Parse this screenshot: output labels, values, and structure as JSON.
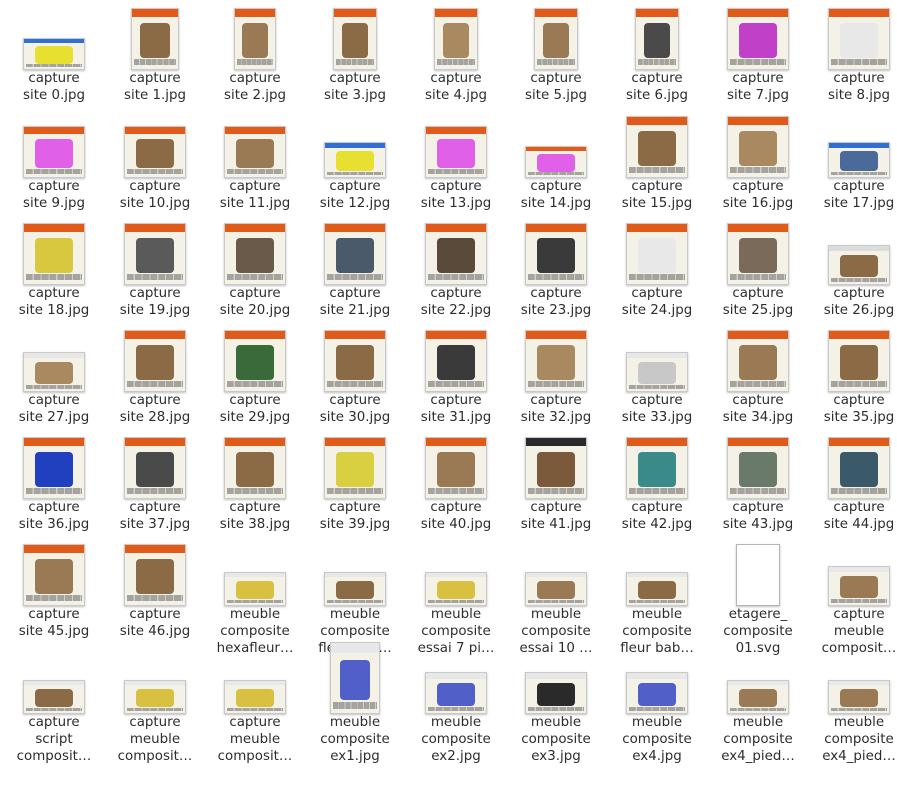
{
  "files": [
    {
      "line1": "capture",
      "line2": "site 0.jpg",
      "thumb": {
        "w": 62,
        "h": 32,
        "bar": "#3070d0",
        "obj": "#e8e030"
      }
    },
    {
      "line1": "capture",
      "line2": "site 1.jpg",
      "thumb": {
        "w": 48,
        "h": 62,
        "bar": "#e05a1a",
        "obj": "#8a6b45"
      }
    },
    {
      "line1": "capture",
      "line2": "site 2.jpg",
      "thumb": {
        "w": 42,
        "h": 62,
        "bar": "#e05a1a",
        "obj": "#9a7a55"
      }
    },
    {
      "line1": "capture",
      "line2": "site 3.jpg",
      "thumb": {
        "w": 44,
        "h": 62,
        "bar": "#e05a1a",
        "obj": "#8a6b45"
      }
    },
    {
      "line1": "capture",
      "line2": "site 4.jpg",
      "thumb": {
        "w": 44,
        "h": 62,
        "bar": "#e05a1a",
        "obj": "#a98a60"
      }
    },
    {
      "line1": "capture",
      "line2": "site 5.jpg",
      "thumb": {
        "w": 44,
        "h": 62,
        "bar": "#e05a1a",
        "obj": "#9a7a55"
      }
    },
    {
      "line1": "capture",
      "line2": "site 6.jpg",
      "thumb": {
        "w": 44,
        "h": 62,
        "bar": "#e05a1a",
        "obj": "#4a4a4a"
      }
    },
    {
      "line1": "capture",
      "line2": "site 7.jpg",
      "thumb": {
        "w": 62,
        "h": 62,
        "bar": "#e05a1a",
        "obj": "#c040c8"
      }
    },
    {
      "line1": "capture",
      "line2": "site 8.jpg",
      "thumb": {
        "w": 62,
        "h": 62,
        "bar": "#e05a1a",
        "obj": "#e8e8e8"
      }
    },
    {
      "line1": "capture",
      "line2": "site 9.jpg",
      "thumb": {
        "w": 62,
        "h": 52,
        "bar": "#e05a1a",
        "obj": "#e060e8"
      }
    },
    {
      "line1": "capture",
      "line2": "site 10.jpg",
      "thumb": {
        "w": 62,
        "h": 52,
        "bar": "#e05a1a",
        "obj": "#8a6b45"
      }
    },
    {
      "line1": "capture",
      "line2": "site 11.jpg",
      "thumb": {
        "w": 62,
        "h": 52,
        "bar": "#e05a1a",
        "obj": "#9a7a55"
      }
    },
    {
      "line1": "capture",
      "line2": "site 12.jpg",
      "thumb": {
        "w": 62,
        "h": 36,
        "bar": "#3070d0",
        "obj": "#e8e030"
      }
    },
    {
      "line1": "capture",
      "line2": "site 13.jpg",
      "thumb": {
        "w": 62,
        "h": 52,
        "bar": "#e05a1a",
        "obj": "#e060e8"
      }
    },
    {
      "line1": "capture",
      "line2": "site 14.jpg",
      "thumb": {
        "w": 62,
        "h": 32,
        "bar": "#e05a1a",
        "obj": "#e060e8"
      }
    },
    {
      "line1": "capture",
      "line2": "site 15.jpg",
      "thumb": {
        "w": 62,
        "h": 62,
        "bar": "#e05a1a",
        "obj": "#8a6b45"
      }
    },
    {
      "line1": "capture",
      "line2": "site 16.jpg",
      "thumb": {
        "w": 62,
        "h": 62,
        "bar": "#e05a1a",
        "obj": "#a98a60"
      }
    },
    {
      "line1": "capture",
      "line2": "site 17.jpg",
      "thumb": {
        "w": 62,
        "h": 36,
        "bar": "#3070d0",
        "obj": "#4a6a9a"
      }
    },
    {
      "line1": "capture",
      "line2": "site 18.jpg",
      "thumb": {
        "w": 62,
        "h": 62,
        "bar": "#e05a1a",
        "obj": "#d8c840"
      }
    },
    {
      "line1": "capture",
      "line2": "site 19.jpg",
      "thumb": {
        "w": 62,
        "h": 62,
        "bar": "#e05a1a",
        "obj": "#5a5a5a"
      }
    },
    {
      "line1": "capture",
      "line2": "site 20.jpg",
      "thumb": {
        "w": 62,
        "h": 62,
        "bar": "#e05a1a",
        "obj": "#6a5a4a"
      }
    },
    {
      "line1": "capture",
      "line2": "site 21.jpg",
      "thumb": {
        "w": 62,
        "h": 62,
        "bar": "#e05a1a",
        "obj": "#4a5a6a"
      }
    },
    {
      "line1": "capture",
      "line2": "site 22.jpg",
      "thumb": {
        "w": 62,
        "h": 62,
        "bar": "#e05a1a",
        "obj": "#5a4a3a"
      }
    },
    {
      "line1": "capture",
      "line2": "site 23.jpg",
      "thumb": {
        "w": 62,
        "h": 62,
        "bar": "#e05a1a",
        "obj": "#3a3a3a"
      }
    },
    {
      "line1": "capture",
      "line2": "site 24.jpg",
      "thumb": {
        "w": 62,
        "h": 62,
        "bar": "#e05a1a",
        "obj": "#e8e8e8"
      }
    },
    {
      "line1": "capture",
      "line2": "site 25.jpg",
      "thumb": {
        "w": 62,
        "h": 62,
        "bar": "#e05a1a",
        "obj": "#7a6a5a"
      }
    },
    {
      "line1": "capture",
      "line2": "site 26.jpg",
      "thumb": {
        "w": 62,
        "h": 40,
        "bar": "#dcdcdc",
        "obj": "#8a6b45"
      }
    },
    {
      "line1": "capture",
      "line2": "site 27.jpg",
      "thumb": {
        "w": 62,
        "h": 40,
        "bar": "#e8e8e8",
        "obj": "#a98a60"
      }
    },
    {
      "line1": "capture",
      "line2": "site 28.jpg",
      "thumb": {
        "w": 62,
        "h": 62,
        "bar": "#e05a1a",
        "obj": "#8a6b45"
      }
    },
    {
      "line1": "capture",
      "line2": "site 29.jpg",
      "thumb": {
        "w": 62,
        "h": 62,
        "bar": "#e05a1a",
        "obj": "#3a6a3a"
      }
    },
    {
      "line1": "capture",
      "line2": "site 30.jpg",
      "thumb": {
        "w": 62,
        "h": 62,
        "bar": "#e05a1a",
        "obj": "#8a6b45"
      }
    },
    {
      "line1": "capture",
      "line2": "site 31.jpg",
      "thumb": {
        "w": 62,
        "h": 62,
        "bar": "#e05a1a",
        "obj": "#3a3a3a"
      }
    },
    {
      "line1": "capture",
      "line2": "site 32.jpg",
      "thumb": {
        "w": 62,
        "h": 62,
        "bar": "#e05a1a",
        "obj": "#a98a60"
      }
    },
    {
      "line1": "capture",
      "line2": "site 33.jpg",
      "thumb": {
        "w": 62,
        "h": 40,
        "bar": "#e8e8e8",
        "obj": "#c8c8c8"
      }
    },
    {
      "line1": "capture",
      "line2": "site 34.jpg",
      "thumb": {
        "w": 62,
        "h": 62,
        "bar": "#e05a1a",
        "obj": "#9a7a55"
      }
    },
    {
      "line1": "capture",
      "line2": "site 35.jpg",
      "thumb": {
        "w": 62,
        "h": 62,
        "bar": "#e05a1a",
        "obj": "#8a6b45"
      }
    },
    {
      "line1": "capture",
      "line2": "site 36.jpg",
      "thumb": {
        "w": 62,
        "h": 62,
        "bar": "#e05a1a",
        "obj": "#2040c0"
      }
    },
    {
      "line1": "capture",
      "line2": "site 37.jpg",
      "thumb": {
        "w": 62,
        "h": 62,
        "bar": "#e05a1a",
        "obj": "#4a4a4a"
      }
    },
    {
      "line1": "capture",
      "line2": "site 38.jpg",
      "thumb": {
        "w": 62,
        "h": 62,
        "bar": "#e05a1a",
        "obj": "#8a6b45"
      }
    },
    {
      "line1": "capture",
      "line2": "site 39.jpg",
      "thumb": {
        "w": 62,
        "h": 62,
        "bar": "#e05a1a",
        "obj": "#d8d040"
      }
    },
    {
      "line1": "capture",
      "line2": "site 40.jpg",
      "thumb": {
        "w": 62,
        "h": 62,
        "bar": "#e05a1a",
        "obj": "#9a7a55"
      }
    },
    {
      "line1": "capture",
      "line2": "site 41.jpg",
      "thumb": {
        "w": 62,
        "h": 62,
        "bar": "#2a2a2a",
        "obj": "#7a5a3a"
      }
    },
    {
      "line1": "capture",
      "line2": "site 42.jpg",
      "thumb": {
        "w": 62,
        "h": 62,
        "bar": "#e05a1a",
        "obj": "#3a8a8a"
      }
    },
    {
      "line1": "capture",
      "line2": "site 43.jpg",
      "thumb": {
        "w": 62,
        "h": 62,
        "bar": "#e05a1a",
        "obj": "#6a7a6a"
      }
    },
    {
      "line1": "capture",
      "line2": "site 44.jpg",
      "thumb": {
        "w": 62,
        "h": 62,
        "bar": "#e05a1a",
        "obj": "#3a5a6a"
      }
    },
    {
      "line1": "capture",
      "line2": "site 45.jpg",
      "thumb": {
        "w": 62,
        "h": 62,
        "bar": "#e05a1a",
        "obj": "#9a7a55"
      }
    },
    {
      "line1": "capture",
      "line2": "site 46.jpg",
      "thumb": {
        "w": 62,
        "h": 62,
        "bar": "#e05a1a",
        "obj": "#8a6b45"
      }
    },
    {
      "line1": "meuble",
      "line2": "composite",
      "line3": "hexafleur…",
      "thumb": {
        "w": 62,
        "h": 34,
        "bar": "#e8e8e8",
        "obj": "#d8c040"
      }
    },
    {
      "line1": "meuble",
      "line2": "composite",
      "line3": "fleur bab…",
      "thumb": {
        "w": 62,
        "h": 34,
        "bar": "#e8e8e8",
        "obj": "#8a6b45"
      }
    },
    {
      "line1": "meuble",
      "line2": "composite",
      "line3": "essai 7 pi…",
      "thumb": {
        "w": 62,
        "h": 34,
        "bar": "#e8e8e8",
        "obj": "#d8c040"
      }
    },
    {
      "line1": "meuble",
      "line2": "composite",
      "line3": "essai 10 …",
      "thumb": {
        "w": 62,
        "h": 34,
        "bar": "#e8e8e8",
        "obj": "#9a7a55"
      }
    },
    {
      "line1": "meuble",
      "line2": "composite",
      "line3": "fleur bab…",
      "thumb": {
        "w": 62,
        "h": 34,
        "bar": "#e8e8e8",
        "obj": "#8a6b45"
      }
    },
    {
      "line1": "etagere_",
      "line2": "composite",
      "line3": "01.svg",
      "thumb": {
        "w": 44,
        "h": 62,
        "bar": "#ffffff",
        "obj": "#ffffff",
        "svg": true
      }
    },
    {
      "line1": "capture",
      "line2": "meuble",
      "line3": "composit…",
      "thumb": {
        "w": 62,
        "h": 40,
        "bar": "#e8e8e8",
        "obj": "#9a7a55"
      }
    },
    {
      "line1": "capture",
      "line2": "script",
      "line3": "composit…",
      "thumb": {
        "w": 62,
        "h": 34,
        "bar": "#e8e8e8",
        "obj": "#8a6b45"
      }
    },
    {
      "line1": "capture",
      "line2": "meuble",
      "line3": "composit…",
      "thumb": {
        "w": 62,
        "h": 34,
        "bar": "#e8e8e8",
        "obj": "#d8c040"
      }
    },
    {
      "line1": "capture",
      "line2": "meuble",
      "line3": "composit…",
      "thumb": {
        "w": 62,
        "h": 34,
        "bar": "#e8e8e8",
        "obj": "#d8c040"
      }
    },
    {
      "line1": "meuble",
      "line2": "composite",
      "line3": "ex1.jpg",
      "thumb": {
        "w": 50,
        "h": 72,
        "bar": "#e8e8e8",
        "obj": "#5060c8"
      }
    },
    {
      "line1": "meuble",
      "line2": "composite",
      "line3": "ex2.jpg",
      "thumb": {
        "w": 62,
        "h": 42,
        "bar": "#e8e8e8",
        "obj": "#5060c8"
      }
    },
    {
      "line1": "meuble",
      "line2": "composite",
      "line3": "ex3.jpg",
      "thumb": {
        "w": 62,
        "h": 42,
        "bar": "#e8e8e8",
        "obj": "#2a2a2a"
      }
    },
    {
      "line1": "meuble",
      "line2": "composite",
      "line3": "ex4.jpg",
      "thumb": {
        "w": 62,
        "h": 42,
        "bar": "#e8e8e8",
        "obj": "#5060c8"
      }
    },
    {
      "line1": "meuble",
      "line2": "composite",
      "line3": "ex4_pied…",
      "thumb": {
        "w": 62,
        "h": 34,
        "bar": "#e8e8e8",
        "obj": "#9a7a55"
      }
    },
    {
      "line1": "meuble",
      "line2": "composite",
      "line3": "ex4_pied…",
      "thumb": {
        "w": 62,
        "h": 34,
        "bar": "#e8e8e8",
        "obj": "#9a7a55"
      }
    }
  ]
}
